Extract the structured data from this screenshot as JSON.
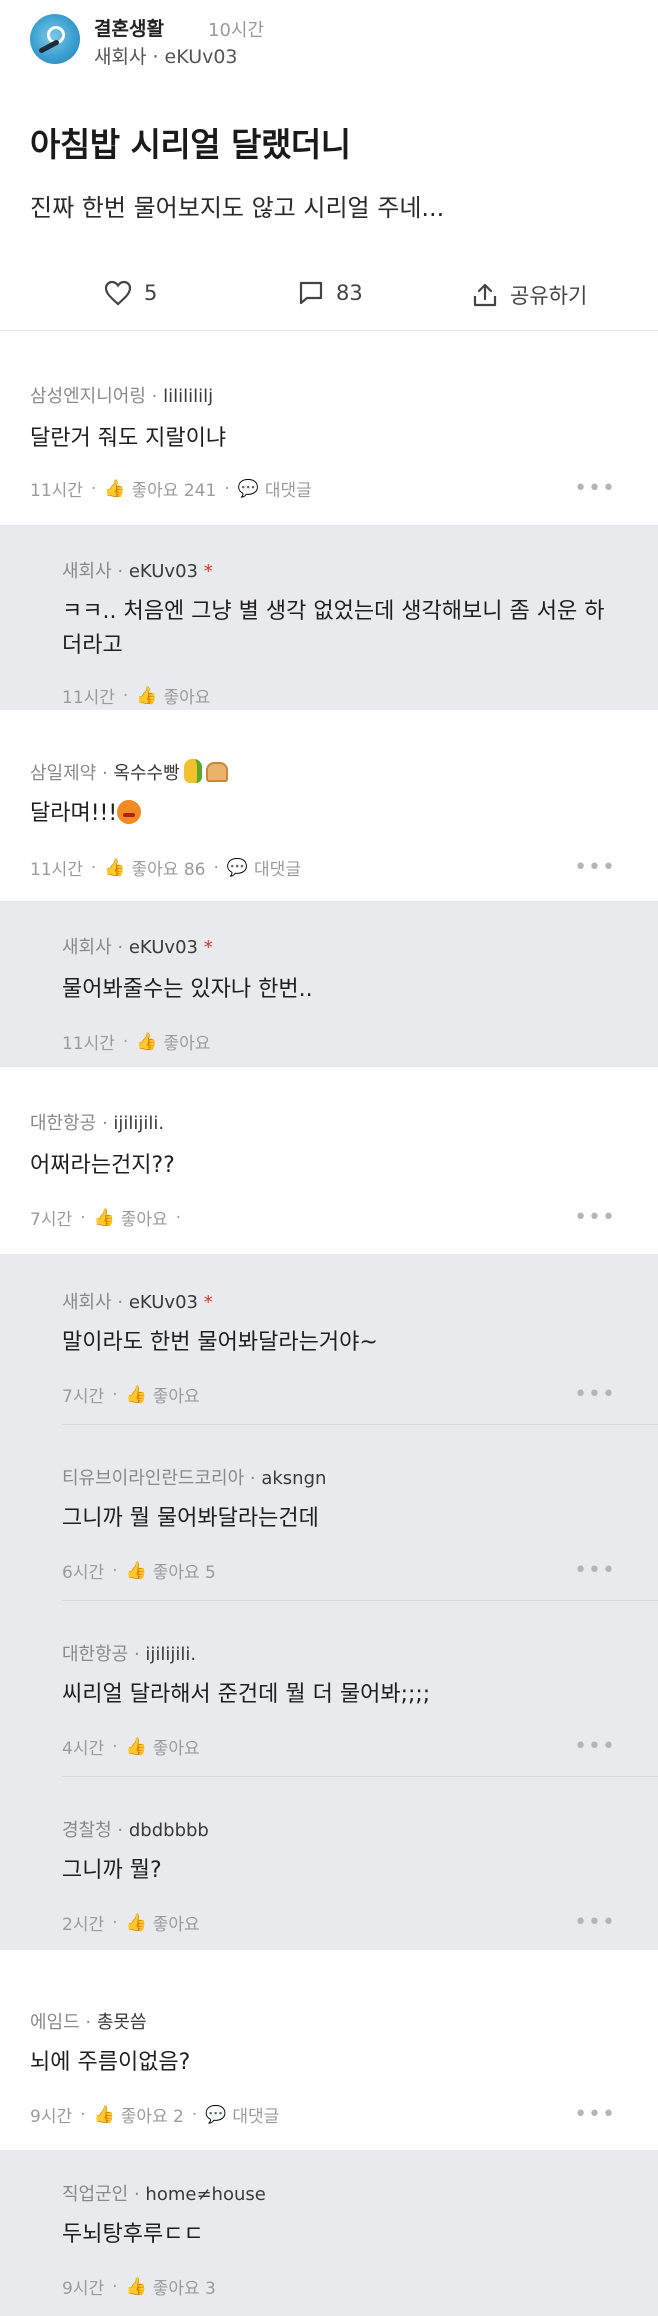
{
  "post": {
    "channel": "결혼생활",
    "time": "10시간",
    "author": "새회사 · eKUv03",
    "title": "아침밥 시리얼 달랬더니",
    "body": "진짜 한번 물어보지도 않고 시리얼 주네...",
    "like_count": "5",
    "comment_count": "83",
    "share_label": "공유하기"
  },
  "labels": {
    "like": "좋아요",
    "reply": "대댓글",
    "more": "•••"
  },
  "comments": [
    {
      "company": "삼성엔지니어링",
      "nick": "lililililj",
      "text": "달란거 줘도 지랄이냐",
      "time": "11시간",
      "likes": "좋아요 241",
      "reply": "대댓글"
    },
    {
      "company": "새회사",
      "nick": "eKUv03",
      "star": "*",
      "text": "ㅋㅋ.. 처음엔 그냥 별 생각 없었는데 생각해보니 좀 서운 하",
      "text2": "더라고",
      "time": "11시간",
      "likes": "좋아요"
    },
    {
      "company": "삼일제약",
      "nick": "옥수수빵",
      "text": "달라며!!!",
      "time": "11시간",
      "likes": "좋아요 86",
      "reply": "대댓글"
    },
    {
      "company": "새회사",
      "nick": "eKUv03",
      "star": "*",
      "text": "물어봐줄수는 있자나 한번..",
      "time": "11시간",
      "likes": "좋아요"
    },
    {
      "company": "대한항공",
      "nick": "ijilijili.",
      "text": "어쩌라는건지??",
      "time": "7시간",
      "likes": "좋아요"
    },
    {
      "company": "새회사",
      "nick": "eKUv03",
      "star": "*",
      "text": "말이라도 한번 물어봐달라는거야~",
      "time": "7시간",
      "likes": "좋아요"
    },
    {
      "company": "티유브이라인란드코리아",
      "nick": "aksngn",
      "text": "그니까 뭘 물어봐달라는건데",
      "time": "6시간",
      "likes": "좋아요 5"
    },
    {
      "company": "대한항공",
      "nick": "ijilijili.",
      "text": "씨리얼 달라해서 준건데 뭘 더 물어봐;;;;",
      "time": "4시간",
      "likes": "좋아요"
    },
    {
      "company": "경찰청",
      "nick": "dbdbbbb",
      "text": "그니까 뭘?",
      "time": "2시간",
      "likes": "좋아요"
    },
    {
      "company": "에임드",
      "nick": "총못씀",
      "text": "뇌에 주름이없음?",
      "time": "9시간",
      "likes": "좋아요 2",
      "reply": "대댓글"
    },
    {
      "company": "직업군인",
      "nick": "home≠house",
      "text": "두뇌탕후루ㄷㄷ",
      "time": "9시간",
      "likes": "좋아요 3"
    }
  ]
}
